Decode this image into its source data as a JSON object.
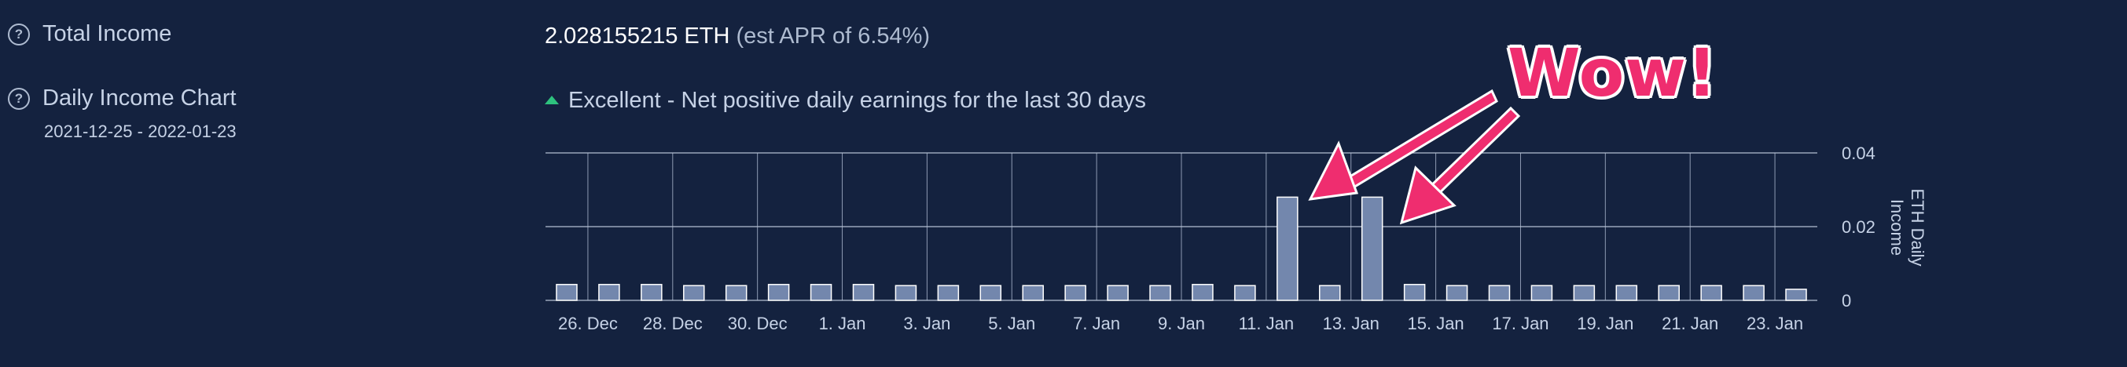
{
  "total_income": {
    "label": "Total Income",
    "value": "2.028155215 ETH",
    "apr": "(est APR of 6.54%)"
  },
  "daily_chart": {
    "label": "Daily Income Chart",
    "date_range": "2021-12-25 - 2022-01-23",
    "status": "Excellent - Net positive daily earnings for the last 30 days"
  },
  "annotation": {
    "text": "Wow!",
    "color": "#ef2d6f"
  },
  "colors": {
    "bar_fill": "#7387ad",
    "bar_stroke": "#ffffff",
    "background": "#14223f",
    "status_up": "#2ec27e"
  },
  "chart_data": {
    "type": "bar",
    "categories": [
      "2021-12-25",
      "2021-12-26",
      "2021-12-27",
      "2021-12-28",
      "2021-12-29",
      "2021-12-30",
      "2021-12-31",
      "2022-01-01",
      "2022-01-02",
      "2022-01-03",
      "2022-01-04",
      "2022-01-05",
      "2022-01-06",
      "2022-01-07",
      "2022-01-08",
      "2022-01-09",
      "2022-01-10",
      "2022-01-11",
      "2022-01-12",
      "2022-01-13",
      "2022-01-14",
      "2022-01-15",
      "2022-01-16",
      "2022-01-17",
      "2022-01-18",
      "2022-01-19",
      "2022-01-20",
      "2022-01-21",
      "2022-01-22",
      "2022-01-23"
    ],
    "values": [
      0.0043,
      0.0043,
      0.0043,
      0.004,
      0.004,
      0.0043,
      0.0043,
      0.0043,
      0.004,
      0.004,
      0.004,
      0.004,
      0.004,
      0.004,
      0.004,
      0.0043,
      0.004,
      0.028,
      0.004,
      0.028,
      0.0043,
      0.004,
      0.004,
      0.004,
      0.004,
      0.004,
      0.004,
      0.004,
      0.004,
      0.003
    ],
    "x_tick_labels": [
      "26. Dec",
      "28. Dec",
      "30. Dec",
      "1. Jan",
      "3. Jan",
      "5. Jan",
      "7. Jan",
      "9. Jan",
      "11. Jan",
      "13. Jan",
      "15. Jan",
      "17. Jan",
      "19. Jan",
      "21. Jan",
      "23. Jan"
    ],
    "x_tick_indices": [
      1,
      3,
      5,
      7,
      9,
      11,
      13,
      15,
      17,
      19,
      21,
      23,
      25,
      27,
      29
    ],
    "y_tick_labels": [
      "0",
      "0.02",
      "0.04"
    ],
    "y_ticks": [
      0,
      0.02,
      0.04
    ],
    "ylim": [
      0,
      0.04
    ],
    "ylabel": "ETH Daily Income",
    "grid": true
  }
}
